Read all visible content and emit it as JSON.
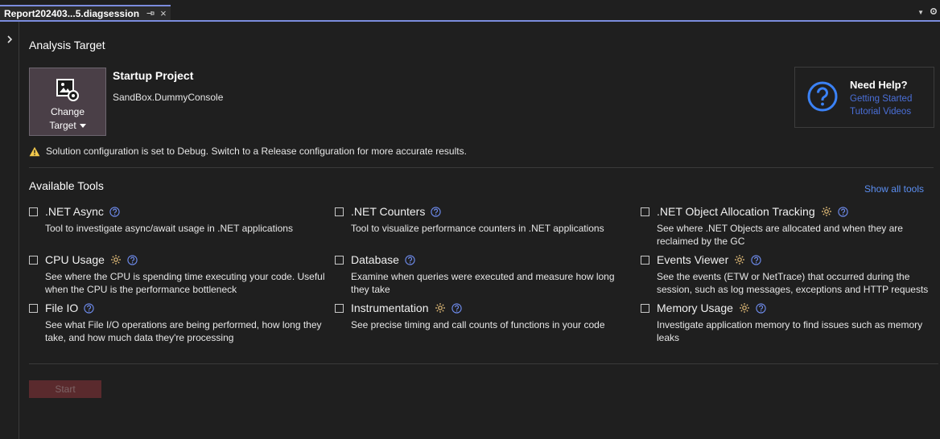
{
  "tab": {
    "title": "Report202403...5.diagsession",
    "close_glyph": "×"
  },
  "analysis_target": {
    "heading": "Analysis Target",
    "change_target_line1": "Change",
    "change_target_line2": "Target",
    "startup_title": "Startup Project",
    "startup_name": "SandBox.DummyConsole"
  },
  "help": {
    "title": "Need Help?",
    "links": [
      "Getting Started",
      "Tutorial Videos"
    ]
  },
  "warning": "Solution configuration is set to Debug. Switch to a Release configuration for more accurate results.",
  "available_tools": {
    "heading": "Available Tools",
    "show_all": "Show all tools",
    "tools": [
      {
        "name": ".NET Async",
        "gear": false,
        "desc": "Tool to investigate async/await usage in .NET applications"
      },
      {
        "name": ".NET Counters",
        "gear": false,
        "desc": "Tool to visualize performance counters in .NET applications"
      },
      {
        "name": ".NET Object Allocation Tracking",
        "gear": true,
        "desc": "See where .NET Objects are allocated and when they are reclaimed by the GC"
      },
      {
        "name": "CPU Usage",
        "gear": true,
        "desc": "See where the CPU is spending time executing your code. Useful when the CPU is the performance bottleneck"
      },
      {
        "name": "Database",
        "gear": false,
        "desc": "Examine when queries were executed and measure how long they take"
      },
      {
        "name": "Events Viewer",
        "gear": true,
        "desc": "See the events (ETW or NetTrace) that occurred during the session, such as log messages, exceptions and HTTP requests"
      },
      {
        "name": "File IO",
        "gear": false,
        "desc": "See what File I/O operations are being performed, how long they take, and how much data they're processing"
      },
      {
        "name": "Instrumentation",
        "gear": true,
        "desc": "See precise timing and call counts of functions in your code"
      },
      {
        "name": "Memory Usage",
        "gear": true,
        "desc": "Investigate application memory to find issues such as memory leaks"
      }
    ]
  },
  "start_label": "Start",
  "colors": {
    "accent": "#7b8cdd",
    "link": "#5b8ef0",
    "help_icon": "#3b82f6",
    "warning": "#f2c94c"
  }
}
